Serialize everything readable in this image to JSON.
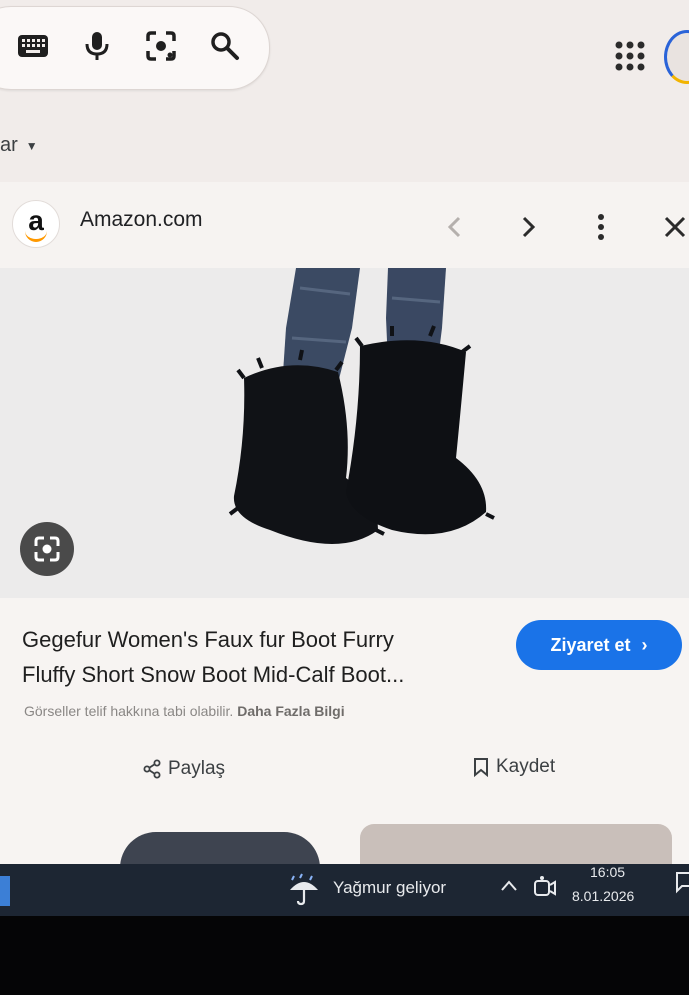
{
  "search_bar": {
    "icons": [
      "keyboard-icon",
      "microphone-icon",
      "lens-icon",
      "search-icon"
    ]
  },
  "header": {
    "apps_icon": "apps-grid-icon"
  },
  "filter_tab": {
    "label": "ar"
  },
  "panel": {
    "site_name": "Amazon.com",
    "favicon_letter": "a",
    "product": {
      "title_line1": "Gegefur Women's Faux fur Boot Furry",
      "title_line2": "Fluffy Short Snow Boot Mid-Calf Boot...",
      "visit_label": "Ziyaret et",
      "copyright_text": "Görseller telif hakkına tabi olabilir.",
      "more_info_link": "Daha Fazla Bilgi",
      "share_label": "Paylaş",
      "save_label": "Kaydet"
    }
  },
  "taskbar": {
    "weather_text": "Yağmur geliyor",
    "time": "16:05",
    "date": "8.01.2026"
  },
  "colors": {
    "visit_button": "#1a73e8",
    "taskbar": "#1d2633",
    "amazon_smile": "#ff9900"
  }
}
